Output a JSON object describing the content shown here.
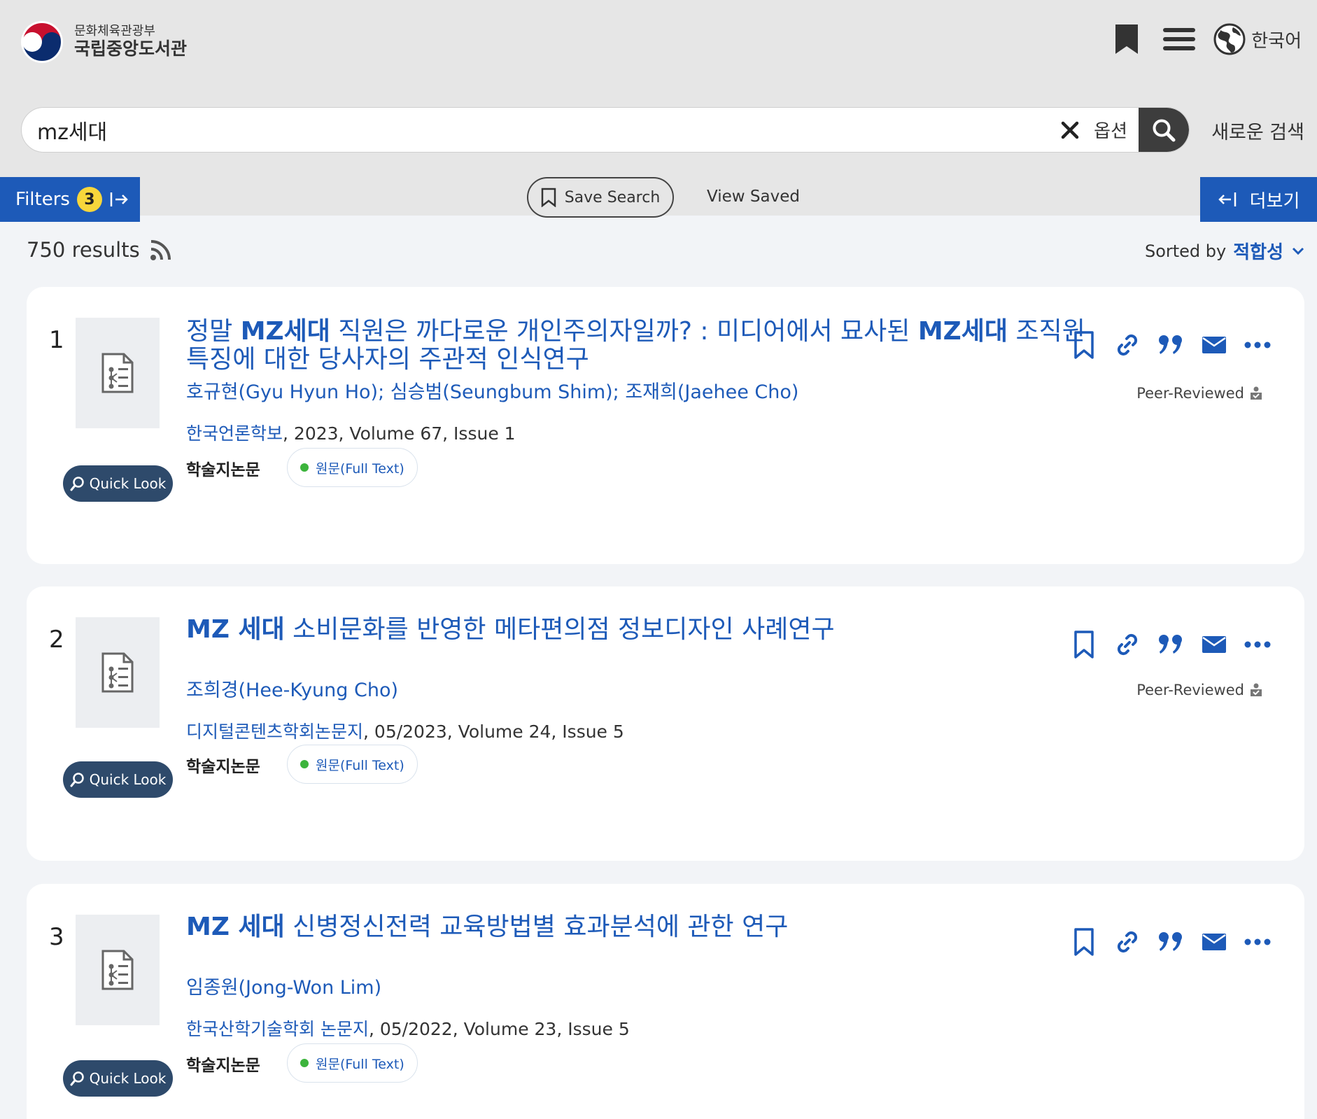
{
  "header": {
    "logo_line1": "문화체육관광부",
    "logo_line2": "국립중앙도서관",
    "language": "한국어"
  },
  "search": {
    "query": "mz세대",
    "options_label": "옵션",
    "new_search_label": "새로운 검색"
  },
  "toolbar": {
    "filters_label": "Filters",
    "filters_count": "3",
    "save_search_label": "Save Search",
    "view_saved_label": "View Saved",
    "more_label": "더보기"
  },
  "results": {
    "count_text": "750 results",
    "sorted_by_label": "Sorted by",
    "sorted_by_value": "적합성",
    "items": [
      {
        "number": "1",
        "title_parts": [
          "정말 ",
          "MZ세대",
          " 직원은 까다로운 개인주의자일까? : 미디어에서 묘사된 ",
          "MZ세대",
          " 조직원 특징에 대한 당사자의 주관적 인식연구"
        ],
        "authors": "호규현(Gyu Hyun Ho); 심승범(Seungbum Shim); 조재희(Jaehee Cho)",
        "journal": "한국언론학보",
        "details": ", 2023, Volume 67, Issue 1",
        "type": "학술지논문",
        "fulltext": "원문(Full Text)",
        "peer_reviewed": "Peer-Reviewed",
        "quick_look": "Quick Look"
      },
      {
        "number": "2",
        "title_parts": [
          "MZ 세대",
          " 소비문화를 반영한 메타편의점 정보디자인 사례연구"
        ],
        "authors": "조희경(Hee-Kyung Cho)",
        "journal": "디지털콘텐츠학회논문지",
        "details": ", 05/2023, Volume 24, Issue 5",
        "type": "학술지논문",
        "fulltext": "원문(Full Text)",
        "peer_reviewed": "Peer-Reviewed",
        "quick_look": "Quick Look"
      },
      {
        "number": "3",
        "title_parts": [
          "MZ 세대",
          " 신병정신전력 교육방법별 효과분석에 관한 연구"
        ],
        "authors": "임종원(Jong-Won Lim)",
        "journal": "한국산학기술학회 논문지",
        "details": ", 05/2022, Volume 23, Issue 5",
        "type": "학술지논문",
        "fulltext": "원문(Full Text)",
        "quick_look": "Quick Look"
      }
    ]
  },
  "colors": {
    "accent": "#1d5ab8",
    "header_bg": "#e6e6e6",
    "quick_look_bg": "#2e4a6b",
    "badge": "#f7d63b"
  }
}
